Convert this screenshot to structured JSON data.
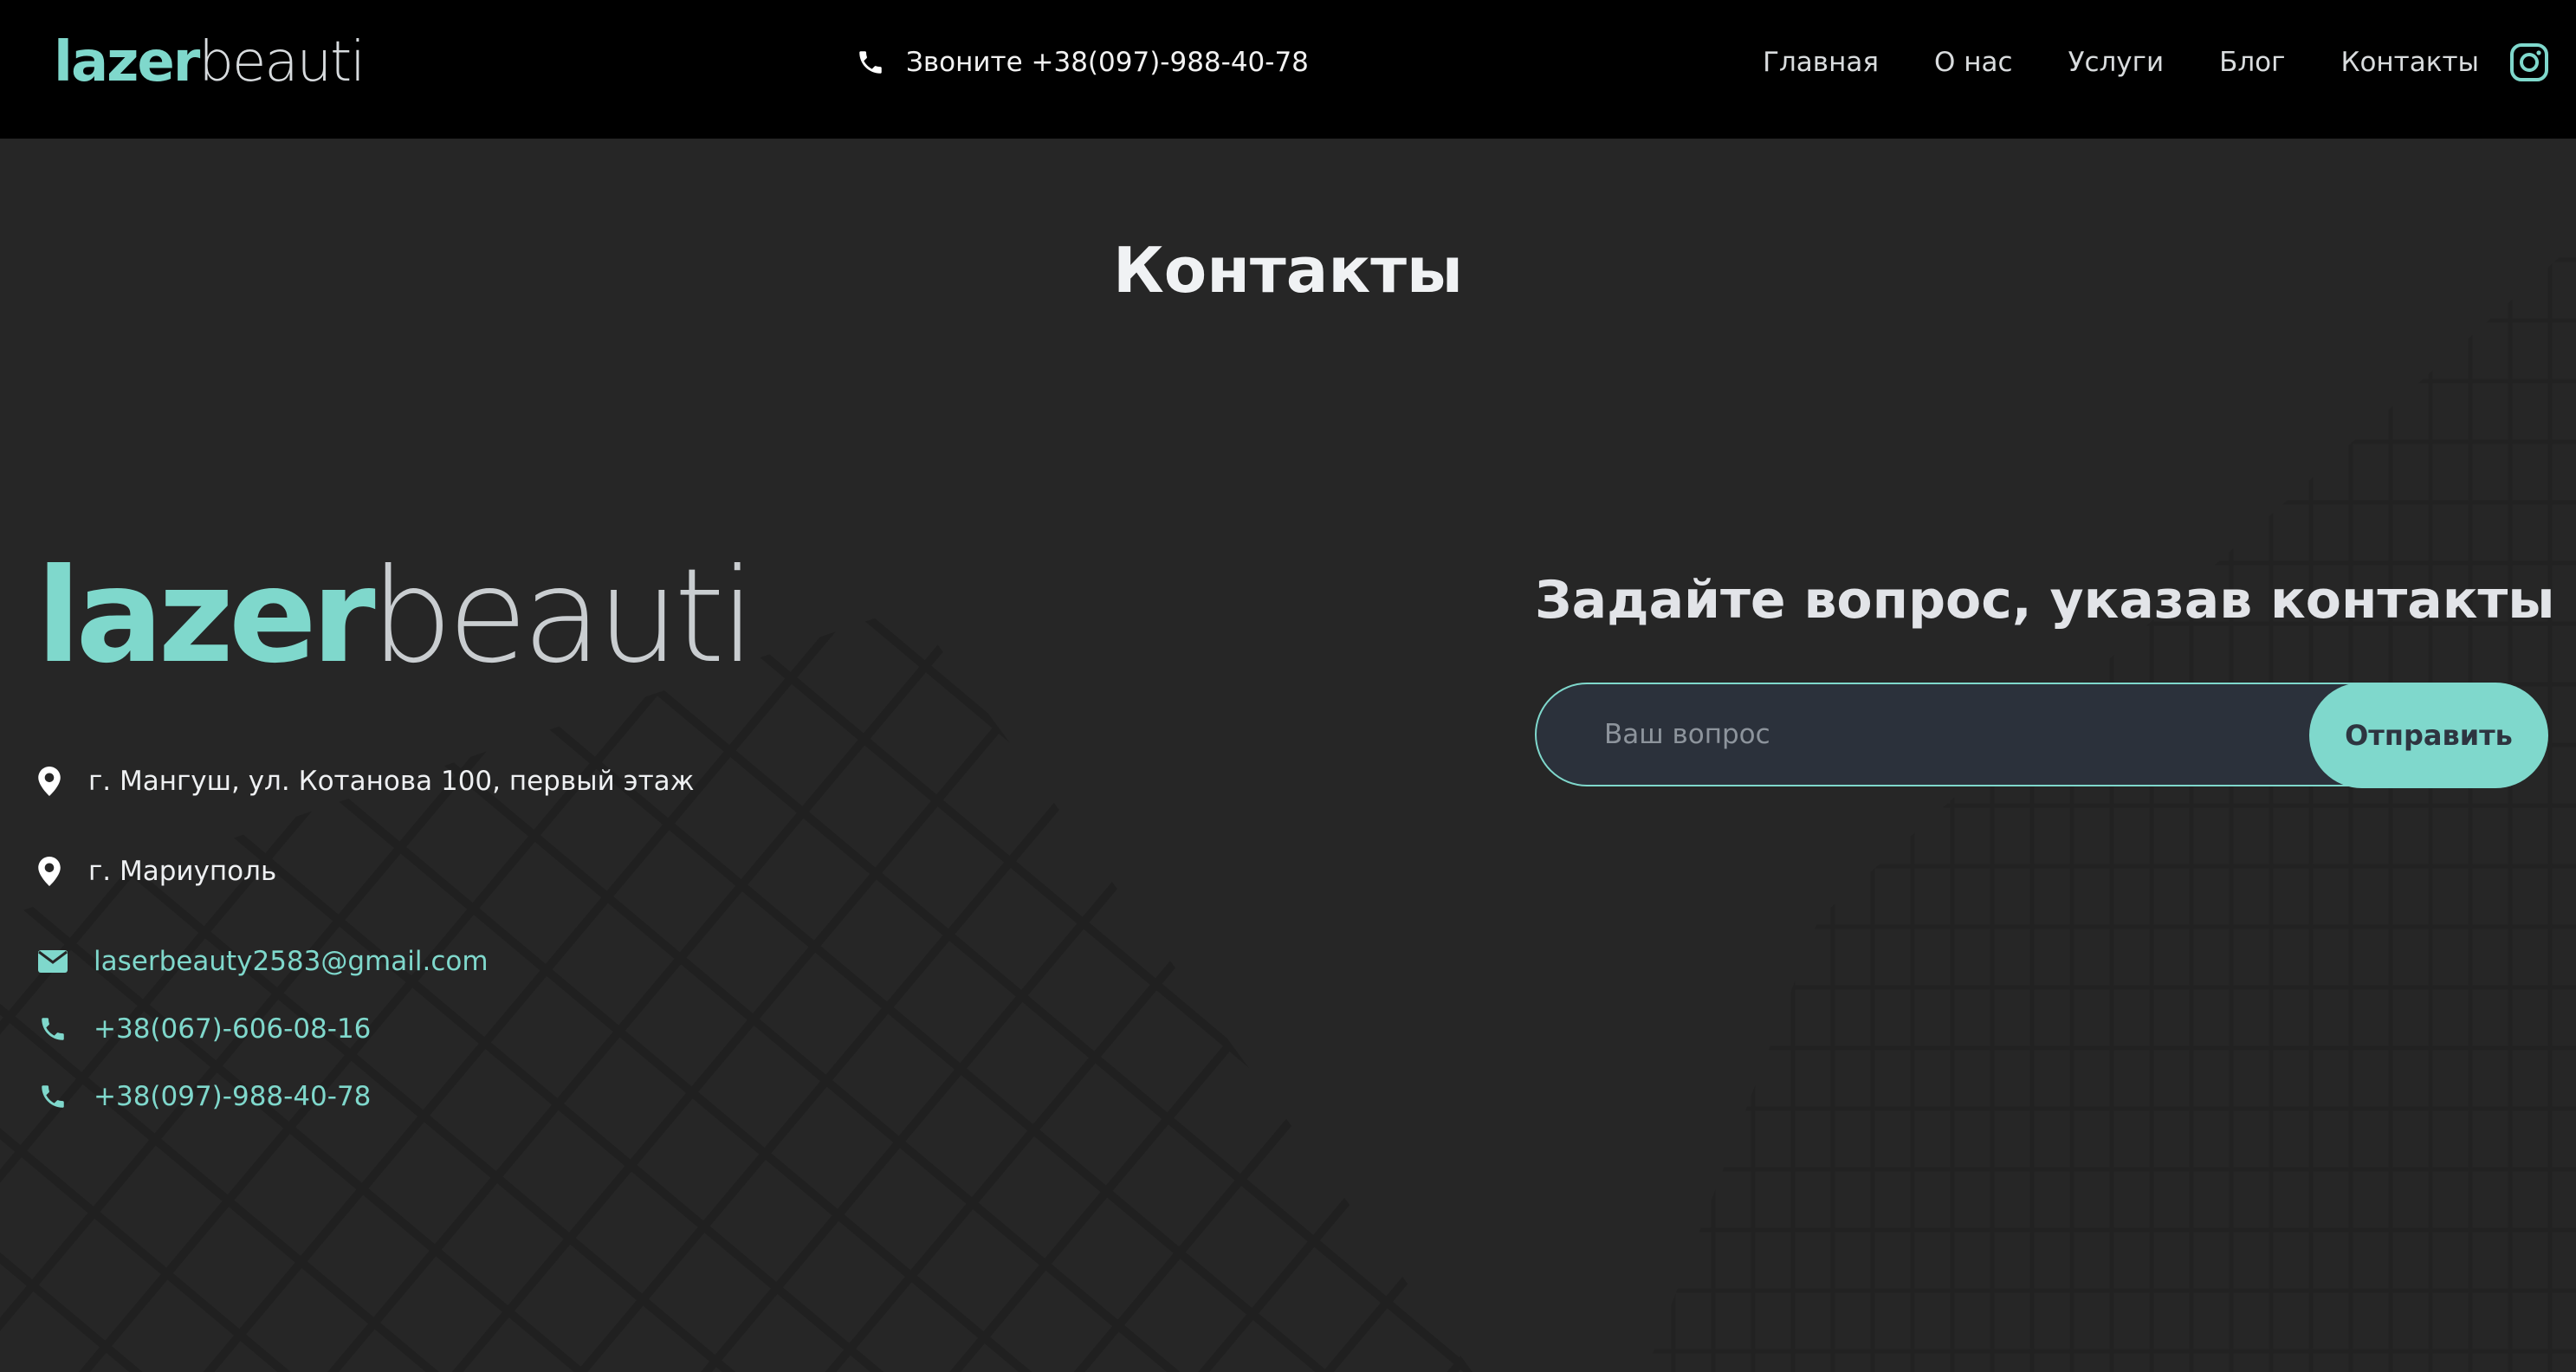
{
  "colors": {
    "accent": "#7fd8cc",
    "header_bg": "#000000",
    "page_bg": "#262626",
    "input_bg": "#2b313b"
  },
  "header": {
    "brand": {
      "part1": "lazer",
      "part2": "beauti"
    },
    "phone_text": "Звоните +38(097)-988-40-78",
    "phone_icon": "phone-icon",
    "nav": [
      {
        "label": "Главная"
      },
      {
        "label": "О нас"
      },
      {
        "label": "Услуги"
      },
      {
        "label": "Блог"
      },
      {
        "label": "Контакты"
      }
    ],
    "social_icon": "instagram-icon"
  },
  "page": {
    "title": "Контакты"
  },
  "contacts": {
    "brand": {
      "part1": "lazer",
      "part2": "beauti"
    },
    "address_1": "г. Мангуш, ул. Котанова 100, первый этаж",
    "address_2": "г. Мариуполь",
    "email": "laserbeauty2583@gmail.com",
    "phone_1": "+38(067)-606-08-16",
    "phone_2": "+38(097)-988-40-78",
    "icons": [
      "map-pin-icon",
      "map-pin-icon",
      "envelope-icon",
      "phone-icon",
      "phone-icon"
    ]
  },
  "form": {
    "title": "Задайте вопрос, указав контакты",
    "input_placeholder": "Ваш вопрос",
    "input_value": "",
    "submit_label": "Отправить"
  }
}
